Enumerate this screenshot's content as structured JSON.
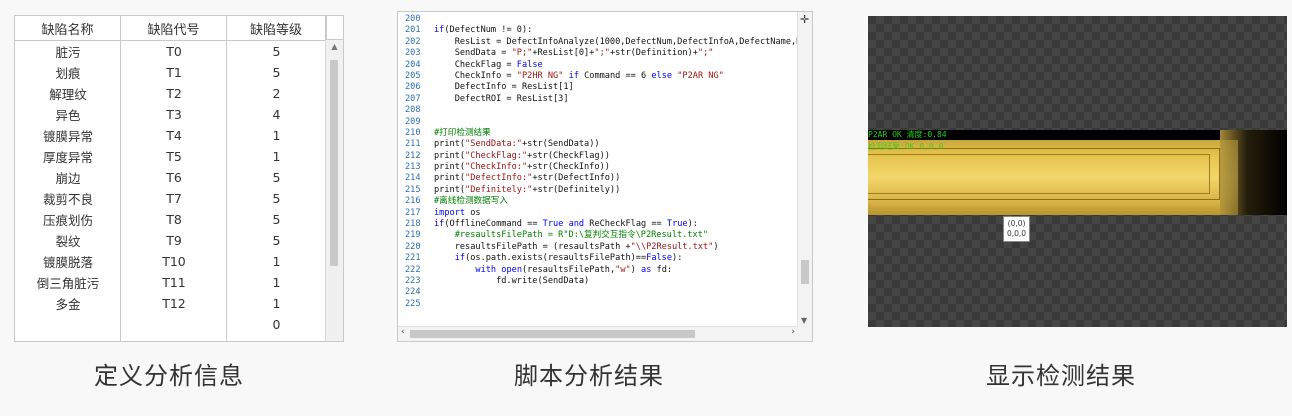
{
  "defect_table": {
    "headers": [
      "缺陷名称",
      "缺陷代号",
      "缺陷等级"
    ],
    "rows": [
      [
        "脏污",
        "T0",
        "5"
      ],
      [
        "划痕",
        "T1",
        "5"
      ],
      [
        "解理纹",
        "T2",
        "2"
      ],
      [
        "异色",
        "T3",
        "4"
      ],
      [
        "镀膜异常",
        "T4",
        "1"
      ],
      [
        "厚度异常",
        "T5",
        "1"
      ],
      [
        "崩边",
        "T6",
        "5"
      ],
      [
        "裁剪不良",
        "T7",
        "5"
      ],
      [
        "压痕划伤",
        "T8",
        "5"
      ],
      [
        "裂纹",
        "T9",
        "5"
      ],
      [
        "镀膜脱落",
        "T10",
        "1"
      ],
      [
        "倒三角脏污",
        "T11",
        "1"
      ],
      [
        "多金",
        "T12",
        "1"
      ],
      [
        "",
        "",
        "0"
      ]
    ]
  },
  "code_editor": {
    "lines": [
      {
        "n": "200",
        "t": ""
      },
      {
        "n": "201",
        "t": "if(DefectNum != 0):"
      },
      {
        "n": "202",
        "t": "    ResList = DefectInfoAnalyze(1000,DefectNum,DefectInfoA,DefectName,D"
      },
      {
        "n": "203",
        "t": "    SendData = \"P;\"+ResList[0]+\";\"+str(Definition)+\";\""
      },
      {
        "n": "204",
        "t": "    CheckFlag = False"
      },
      {
        "n": "205",
        "t": "    CheckInfo = \"P2HR NG\" if Command == 6 else \"P2AR NG\""
      },
      {
        "n": "206",
        "t": "    DefectInfo = ResList[1]"
      },
      {
        "n": "207",
        "t": "    DefectROI = ResList[3]"
      },
      {
        "n": "208",
        "t": ""
      },
      {
        "n": "209",
        "t": ""
      },
      {
        "n": "210",
        "t": "#打印检测结果"
      },
      {
        "n": "211",
        "t": "print(\"SendData:\"+str(SendData))"
      },
      {
        "n": "212",
        "t": "print(\"CheckFlag:\"+str(CheckFlag))"
      },
      {
        "n": "213",
        "t": "print(\"CheckInfo:\"+str(CheckInfo))"
      },
      {
        "n": "214",
        "t": "print(\"DefectInfo:\"+str(DefectInfo))"
      },
      {
        "n": "215",
        "t": "print(\"Definitely:\"+str(Definitely))"
      },
      {
        "n": "216",
        "t": "#离线检测数据写入"
      },
      {
        "n": "217",
        "t": "import os"
      },
      {
        "n": "218",
        "t": "if(OfflineCommand == True and ReCheckFlag == True):"
      },
      {
        "n": "219",
        "t": "    #resaultsFilePath = R\"D:\\复判交互指令\\P2Result.txt\""
      },
      {
        "n": "220",
        "t": "    resaultsFilePath = (resaultsPath +\"\\\\P2Result.txt\")"
      },
      {
        "n": "221",
        "t": "    if(os.path.exists(resaultsFilePath)==False):"
      },
      {
        "n": "222",
        "t": "        with open(resaultsFilePath,\"w\") as fd:"
      },
      {
        "n": "223",
        "t": "            fd.write(SendData)"
      },
      {
        "n": "224",
        "t": ""
      },
      {
        "n": "225",
        "t": ""
      }
    ]
  },
  "viewer": {
    "overlay_line1": "P2AR OK 清度:0.84",
    "overlay_line2": "检测结果:OK 0,0,0",
    "coord_line1": "(0,0)",
    "coord_line2": "0,0,0"
  },
  "captions": {
    "left": "定义分析信息",
    "middle": "脚本分析结果",
    "right": "显示检测结果"
  },
  "colors": {
    "line_number": "#2b6fb6",
    "keyword": "#0000ff",
    "string": "#a31515",
    "comment": "#008000",
    "overlay_text": "#19d119"
  }
}
